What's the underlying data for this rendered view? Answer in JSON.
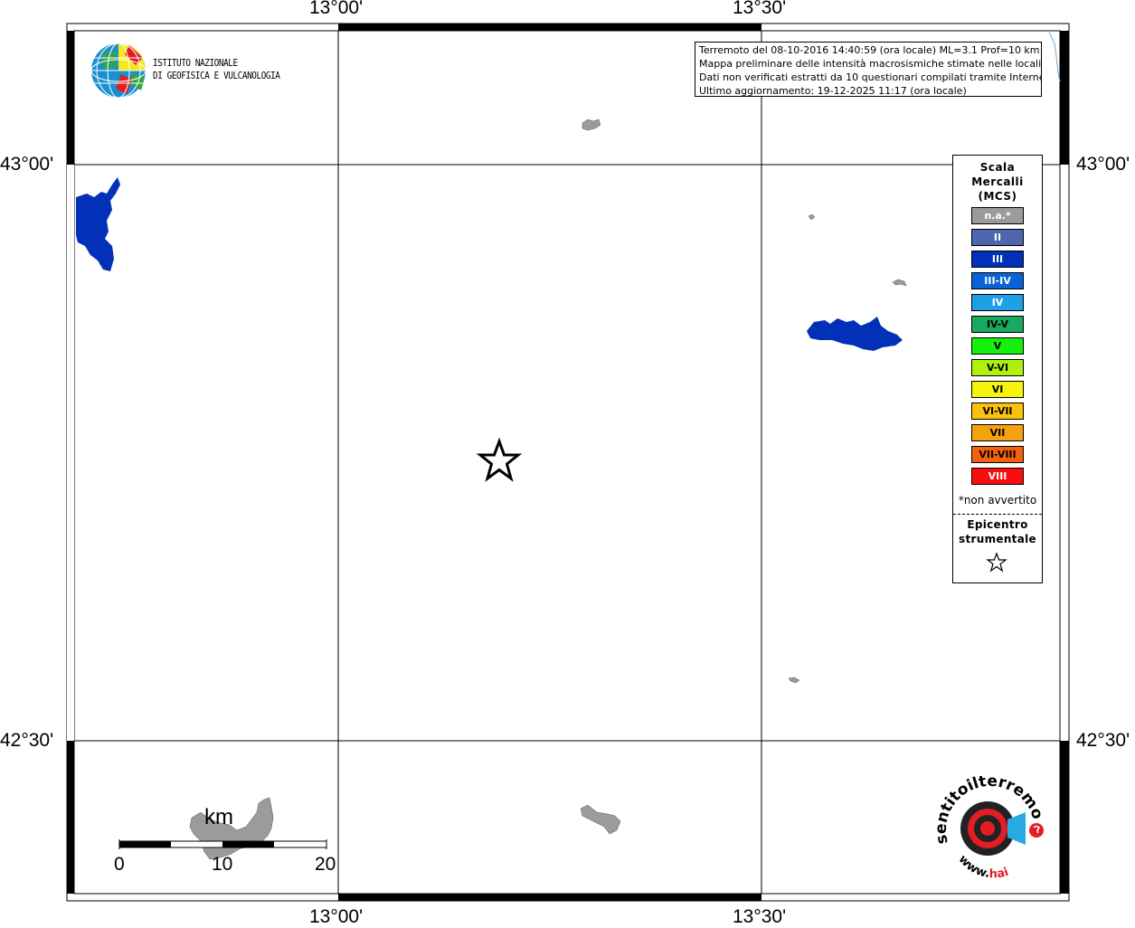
{
  "map_labels": {
    "lon_left": "13°00'",
    "lon_right": "13°30'",
    "lat_top": "43°00'",
    "lat_bottom": "42°30'"
  },
  "institute": {
    "line1": "ISTITUTO NAZIONALE",
    "line2": "DI GEOFISICA E VULCANOLOGIA"
  },
  "info": {
    "line1": "Terremoto del 08-10-2016 14:40:59 (ora locale) ML=3.1 Prof=10 km",
    "line2": "Mappa preliminare delle intensità macrosismiche stimate nelle località",
    "line3": "Dati non verificati estratti da 10 questionari compilati tramite Internet.",
    "line4": "Ultimo aggiornamento: 19-12-2025 11:17 (ora locale)"
  },
  "legend": {
    "title_line1": "Scala",
    "title_line2": "Mercalli",
    "title_line3": "(MCS)",
    "items": [
      {
        "label": "n.a.*",
        "color": "#9b9b9b",
        "text": "#ffffff"
      },
      {
        "label": "II",
        "color": "#4e66ad",
        "text": "#ffffff"
      },
      {
        "label": "III",
        "color": "#0230b8",
        "text": "#ffffff"
      },
      {
        "label": "III-IV",
        "color": "#0a63d6",
        "text": "#ffffff"
      },
      {
        "label": "IV",
        "color": "#1f9fe6",
        "text": "#ffffff"
      },
      {
        "label": "IV-V",
        "color": "#1aa95e",
        "text": "#000000"
      },
      {
        "label": "V",
        "color": "#16f00e",
        "text": "#000000"
      },
      {
        "label": "V-VI",
        "color": "#aef10d",
        "text": "#000000"
      },
      {
        "label": "VI",
        "color": "#f6f40c",
        "text": "#000000"
      },
      {
        "label": "VI-VII",
        "color": "#f9c10c",
        "text": "#000000"
      },
      {
        "label": "VII",
        "color": "#f8a10e",
        "text": "#000000"
      },
      {
        "label": "VII-VIII",
        "color": "#f4610e",
        "text": "#000000"
      },
      {
        "label": "VIII",
        "color": "#f80e0e",
        "text": "#ffffff"
      }
    ],
    "na_note": "*non avvertito",
    "epi_line1": "Epicentro",
    "epi_line2": "strumentale"
  },
  "scale_bar": {
    "unit": "km",
    "ticks": [
      "0",
      "10",
      "20"
    ]
  },
  "colors": {
    "intensity_III": "#0230b8",
    "not_felt": "#9b9b9b"
  }
}
